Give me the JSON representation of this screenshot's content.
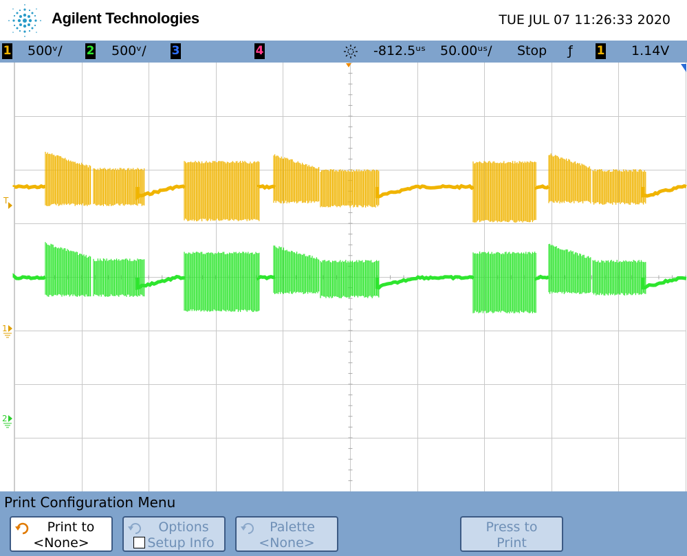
{
  "header": {
    "brand": "Agilent Technologies",
    "timestamp": "TUE JUL 07 11:26:33 2020"
  },
  "status": {
    "ch1": {
      "num": "1",
      "scale": "500",
      "unit": "ᵛ/",
      "color": "#f0b400"
    },
    "ch2": {
      "num": "2",
      "scale": "500",
      "unit": "ᵛ/",
      "color": "#2ee52e"
    },
    "ch3": {
      "num": "3",
      "color": "#3070ff"
    },
    "ch4": {
      "num": "4",
      "color": "#ff3c8c"
    },
    "delay": "-812.5",
    "delay_unit": "ᵘˢ",
    "timebase": "50.00",
    "timebase_unit": "ᵘˢ/",
    "run_state": "Stop",
    "trigger_slope": "ƒ",
    "trigger_source": "1",
    "trigger_level": "1.14V"
  },
  "markers": {
    "trigger_label": "T",
    "ch1_label": "1",
    "ch2_label": "2"
  },
  "menu": {
    "title": "Print Configuration Menu",
    "softkeys": [
      {
        "line1": "Print to",
        "line2": "<None>",
        "enabled": true
      },
      {
        "line1": "Options",
        "line2": "Setup Info",
        "enabled": false
      },
      {
        "line1": "Palette",
        "line2": "<None>",
        "enabled": false
      },
      {
        "line1": "Press to",
        "line2": "Print",
        "enabled": false
      }
    ]
  }
}
